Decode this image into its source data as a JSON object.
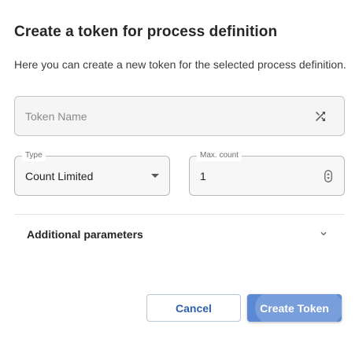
{
  "dialog": {
    "title": "Create a token for process definition",
    "subtitle": "Here you can create a new token for the selected process definition."
  },
  "token_name": {
    "value": "",
    "placeholder": "Token Name",
    "generate_icon": "shuffle-icon"
  },
  "type_field": {
    "label": "Type",
    "value": "Count Limited",
    "icon": "caret-down-icon"
  },
  "max_count_field": {
    "label": "Max. count",
    "value": "1",
    "icon": "stepper-icon"
  },
  "additional": {
    "label": "Additional parameters",
    "icon": "chevron-down-icon"
  },
  "actions": {
    "cancel_label": "Cancel",
    "create_label": "Create Token"
  },
  "colors": {
    "primary": "#5b89d3",
    "cancel_text": "#2f5fa8"
  }
}
